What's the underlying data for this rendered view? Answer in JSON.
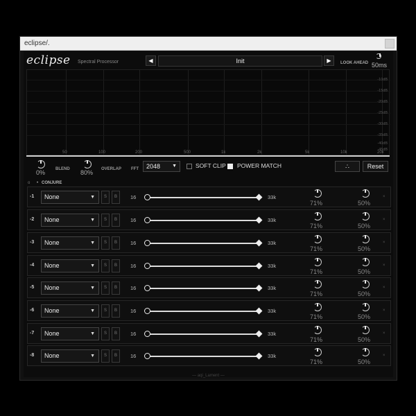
{
  "window": {
    "title": "eclipse/."
  },
  "header": {
    "logo": "eclipse",
    "subtitle": "Spectral Processor",
    "preset_prev_icon": "triangle-left",
    "preset_name": "Init",
    "preset_next_icon": "triangle-right",
    "look_ahead_label": "LOOK AHEAD",
    "look_ahead_value": "50ms"
  },
  "analyzer": {
    "db_labels": [
      "-10dB",
      "-15dB",
      "-20dB",
      "-25dB",
      "-30dB",
      "-35dB",
      "-40dB",
      "-45dB"
    ],
    "freq_labels": [
      "50",
      "100",
      "200",
      "500",
      "1k",
      "2k",
      "5k",
      "10k",
      "20k"
    ]
  },
  "controls": {
    "blend_value": "0%",
    "blend_label": "BLEND",
    "overlap_value": "80%",
    "overlap_label": "OVERLAP",
    "fft_label": "FFT",
    "fft_value": "2048",
    "soft_clip_label": "SOFT CLIP",
    "soft_clip_checked": false,
    "power_match_label": "POWER MATCH",
    "power_match_checked": true,
    "randomize_icon": "dots-icon",
    "reset_label": "Reset"
  },
  "section": {
    "toggle": "o",
    "label": "CONJURE"
  },
  "rows": [
    {
      "num": "-1",
      "module": "None",
      "s": "S",
      "b": "B",
      "min": "16",
      "max": "33k",
      "val1": "71%",
      "val2": "50%"
    },
    {
      "num": "-2",
      "module": "None",
      "s": "S",
      "b": "B",
      "min": "16",
      "max": "33k",
      "val1": "71%",
      "val2": "50%"
    },
    {
      "num": "-3",
      "module": "None",
      "s": "S",
      "b": "B",
      "min": "16",
      "max": "33k",
      "val1": "71%",
      "val2": "50%"
    },
    {
      "num": "-4",
      "module": "None",
      "s": "S",
      "b": "B",
      "min": "16",
      "max": "33k",
      "val1": "71%",
      "val2": "50%"
    },
    {
      "num": "-5",
      "module": "None",
      "s": "S",
      "b": "B",
      "min": "16",
      "max": "33k",
      "val1": "71%",
      "val2": "50%"
    },
    {
      "num": "-6",
      "module": "None",
      "s": "S",
      "b": "B",
      "min": "16",
      "max": "33k",
      "val1": "71%",
      "val2": "50%"
    },
    {
      "num": "-7",
      "module": "None",
      "s": "S",
      "b": "B",
      "min": "16",
      "max": "33k",
      "val1": "71%",
      "val2": "50%"
    },
    {
      "num": "-8",
      "module": "None",
      "s": "S",
      "b": "B",
      "min": "16",
      "max": "33k",
      "val1": "71%",
      "val2": "50%"
    }
  ],
  "footer": {
    "text": "— aqi_Lament —"
  },
  "colors": {
    "background": "#000000",
    "panel": "#0c0c0c",
    "accent": "#eeeeee"
  }
}
